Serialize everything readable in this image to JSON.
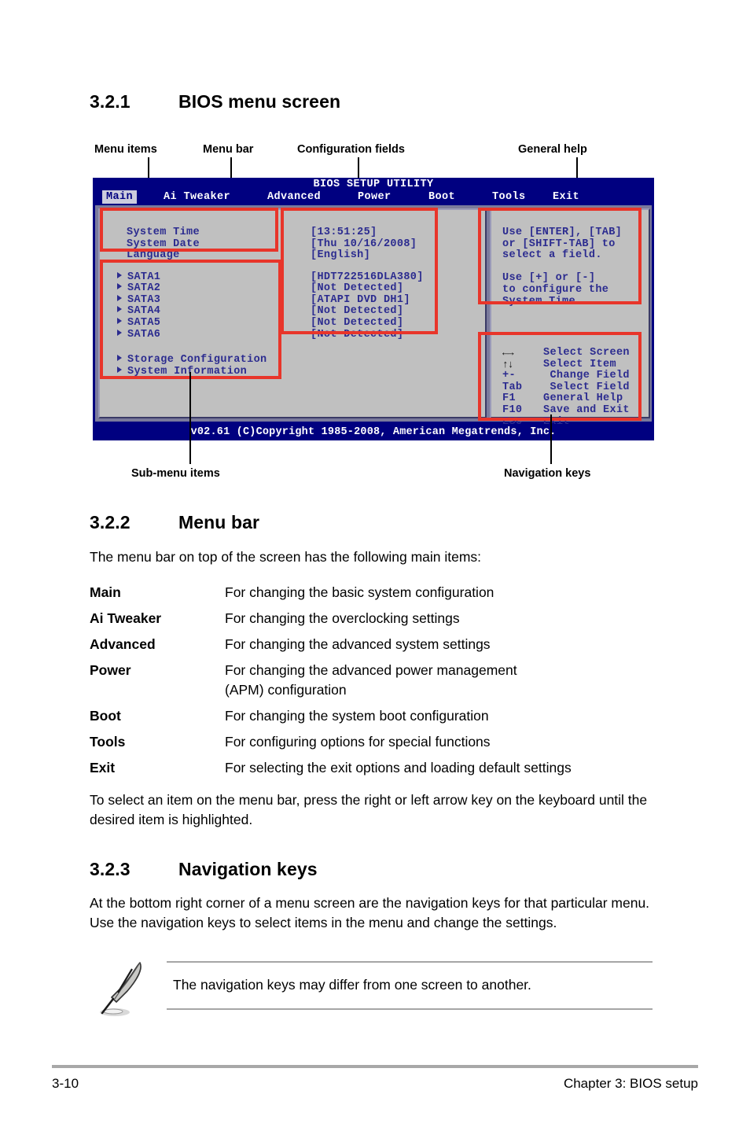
{
  "sections": {
    "s321": {
      "num": "3.2.1",
      "title": "BIOS menu screen"
    },
    "s322": {
      "num": "3.2.2",
      "title": "Menu bar"
    },
    "s323": {
      "num": "3.2.3",
      "title": "Navigation keys"
    }
  },
  "callouts": {
    "menu_items": "Menu items",
    "menu_bar": "Menu bar",
    "configuration_fields": "Configuration fields",
    "general_help": "General help",
    "sub_menu_items": "Sub-menu items",
    "navigation_keys": "Navigation keys"
  },
  "bios": {
    "title": "BIOS SETUP UTILITY",
    "menu_tabs": [
      {
        "label": "Main",
        "active": true
      },
      {
        "label": "Ai Tweaker",
        "active": false
      },
      {
        "label": "Advanced",
        "active": false
      },
      {
        "label": "Power",
        "active": false
      },
      {
        "label": "Boot",
        "active": false
      },
      {
        "label": "Tools",
        "active": false
      },
      {
        "label": "Exit",
        "active": false
      }
    ],
    "menu_items": [
      {
        "label": "System Time",
        "value": "[13:51:25]"
      },
      {
        "label": "System Date",
        "value": "[Thu 10/16/2008]"
      },
      {
        "label": "Language",
        "value": "[English]"
      }
    ],
    "submenu_items": [
      {
        "label": "SATA1",
        "value": "[HDT722516DLA380]"
      },
      {
        "label": "SATA2",
        "value": "[Not Detected]"
      },
      {
        "label": "SATA3",
        "value": "[ATAPI DVD DH1]"
      },
      {
        "label": "SATA4",
        "value": "[Not Detected]"
      },
      {
        "label": "SATA5",
        "value": "[Not Detected]"
      },
      {
        "label": "SATA6",
        "value": "[Not Detected]"
      }
    ],
    "submenu_items_2": [
      {
        "label": "Storage Configuration"
      },
      {
        "label": "System Information"
      }
    ],
    "help_lines": [
      "Use [ENTER], [TAB]",
      "or [SHIFT-TAB] to",
      "select a field.",
      "",
      "Use [+] or [-]",
      "to configure the",
      "System Time."
    ],
    "nav_keys": [
      {
        "key": "←→",
        "glyph": true,
        "desc": "Select Screen"
      },
      {
        "key": "↑↓",
        "glyph": true,
        "desc": "Select Item"
      },
      {
        "key": "+-",
        "glyph": false,
        "desc": " Change Field"
      },
      {
        "key": "Tab",
        "glyph": false,
        "desc": " Select Field"
      },
      {
        "key": "F1",
        "glyph": false,
        "desc": "General Help"
      },
      {
        "key": "F10",
        "glyph": false,
        "desc": "Save and Exit"
      },
      {
        "key": "ESC",
        "glyph": false,
        "desc": "Exit"
      }
    ],
    "footer": "v02.61 (C)Copyright 1985-2008, American Megatrends, Inc.",
    "colors": {
      "header_blue": "#000080",
      "pane_gray": "#c0c0c0",
      "text_blue": "#2b2b8f",
      "annotation_red": "#e8352a",
      "active_tab_bg": "#ccccdd"
    }
  },
  "menubar_section": {
    "intro": "The menu bar on top of the screen has the following main items:",
    "entries": [
      {
        "term": "Main",
        "desc": "For changing the basic system configuration"
      },
      {
        "term": "Ai Tweaker",
        "desc": "For changing the overclocking settings"
      },
      {
        "term": "Advanced",
        "desc": "For changing the advanced system settings"
      },
      {
        "term": "Power",
        "desc": "For changing the advanced power management (APM) configuration"
      },
      {
        "term": "Boot",
        "desc": "For changing the system boot configuration"
      },
      {
        "term": "Tools",
        "desc": "For configuring options for special functions"
      },
      {
        "term": "Exit",
        "desc": "For selecting the exit options and loading default settings"
      }
    ],
    "outro": "To select an item on the menu bar, press the right or left arrow key on the keyboard until the desired item is highlighted."
  },
  "navkeys_section": {
    "body": "At the bottom right corner of a menu screen are the navigation keys for that particular menu. Use the navigation keys to select items in the menu and change the settings."
  },
  "note": {
    "text": "The navigation keys may differ from one screen to another."
  },
  "footer": {
    "page": "3-10",
    "chapter": "Chapter 3: BIOS setup"
  }
}
